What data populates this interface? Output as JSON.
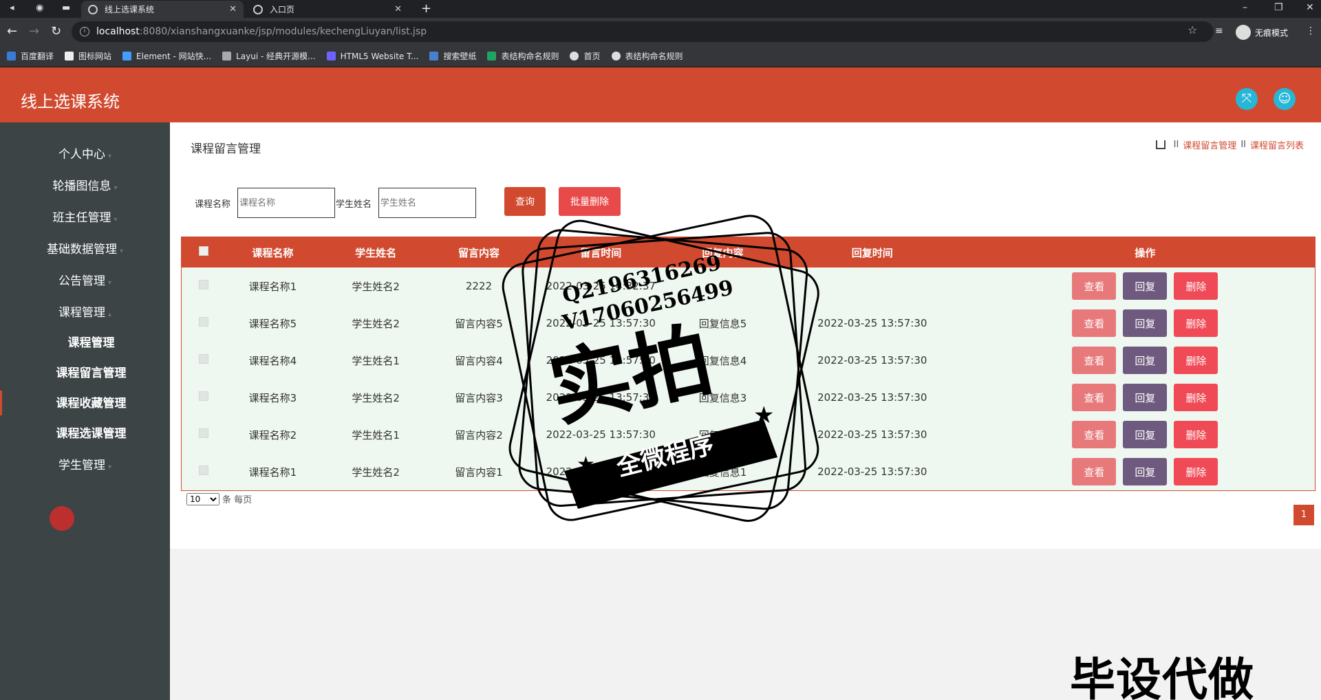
{
  "browser": {
    "tabs": [
      {
        "title": "线上选课系统",
        "active": true
      },
      {
        "title": "入口页",
        "active": false
      }
    ],
    "url_host": "localhost",
    "url_path": ":8080/xianshangxuanke/jsp/modules/kechengLiuyan/list.jsp",
    "incognito_label": "无痕模式",
    "bookmarks": [
      "百度翻译",
      "图标网站",
      "Element - 网站快...",
      "Layui - 经典开源模...",
      "HTML5 Website T...",
      "搜索壁纸",
      "表结构命名规则",
      "首页",
      "表结构命名规则"
    ]
  },
  "app": {
    "title": "线上选课系统",
    "accent_color": "#d14a30"
  },
  "sidebar": {
    "items": [
      {
        "label": "个人中心",
        "sub": false
      },
      {
        "label": "轮播图信息",
        "sub": false
      },
      {
        "label": "班主任管理",
        "sub": false
      },
      {
        "label": "基础数据管理",
        "sub": false
      },
      {
        "label": "公告管理",
        "sub": false
      },
      {
        "label": "课程管理",
        "sub": false
      },
      {
        "label": "课程管理",
        "sub": true
      },
      {
        "label": "课程留言管理",
        "sub": true
      },
      {
        "label": "课程收藏管理",
        "sub": true
      },
      {
        "label": "课程选课管理",
        "sub": true
      },
      {
        "label": "学生管理",
        "sub": false
      }
    ]
  },
  "page": {
    "title": "课程留言管理",
    "breadcrumb": [
      "课程留言管理",
      "课程留言列表"
    ]
  },
  "search": {
    "course_label": "课程名称",
    "course_placeholder": "课程名称",
    "student_label": "学生姓名",
    "student_placeholder": "学生姓名",
    "query_button": "查询",
    "batch_delete_button": "批量删除"
  },
  "table": {
    "headers": [
      "课程名称",
      "学生姓名",
      "留言内容",
      "留言时间",
      "回复内容",
      "回复时间",
      "操作"
    ],
    "rows": [
      {
        "course": "课程名称1",
        "student": "学生姓名2",
        "content": "2222",
        "time": "2022-03-25 14:32:37",
        "reply": "",
        "reply_time": ""
      },
      {
        "course": "课程名称5",
        "student": "学生姓名2",
        "content": "留言内容5",
        "time": "2022-03-25 13:57:30",
        "reply": "回复信息5",
        "reply_time": "2022-03-25 13:57:30"
      },
      {
        "course": "课程名称4",
        "student": "学生姓名1",
        "content": "留言内容4",
        "time": "2022-03-25 13:57:30",
        "reply": "回复信息4",
        "reply_time": "2022-03-25 13:57:30"
      },
      {
        "course": "课程名称3",
        "student": "学生姓名2",
        "content": "留言内容3",
        "time": "2022-03-25 13:57:30",
        "reply": "回复信息3",
        "reply_time": "2022-03-25 13:57:30"
      },
      {
        "course": "课程名称2",
        "student": "学生姓名1",
        "content": "留言内容2",
        "time": "2022-03-25 13:57:30",
        "reply": "回复信息2",
        "reply_time": "2022-03-25 13:57:30"
      },
      {
        "course": "课程名称1",
        "student": "学生姓名2",
        "content": "留言内容1",
        "time": "2022-03-25 13:57:30",
        "reply": "回复信息1",
        "reply_time": "2022-03-25 13:57:30"
      }
    ],
    "actions": {
      "view": "查看",
      "reply": "回复",
      "delete": "删除"
    }
  },
  "pager": {
    "page_size": "10",
    "per_page_label": "条 每页",
    "current_page": "1"
  },
  "watermark": {
    "contact_q": "Q2196316269",
    "contact_v": "V17060256499",
    "stamp_main": "实拍",
    "stamp_banner": "全微程序",
    "bottom_text": "毕设代做"
  }
}
